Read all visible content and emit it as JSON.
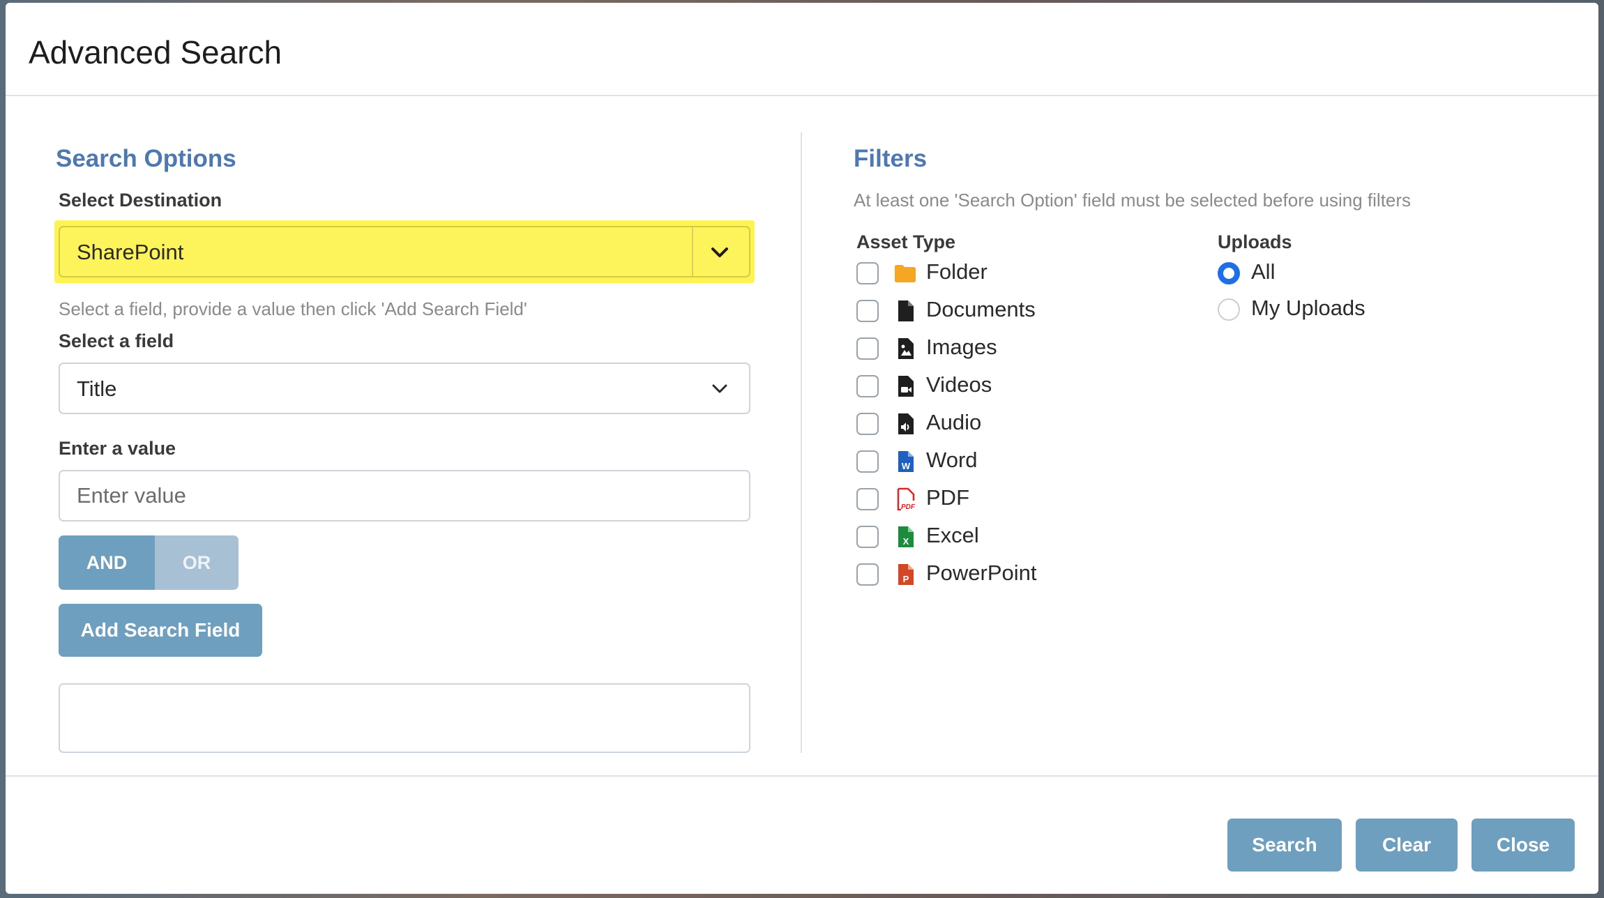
{
  "dialog": {
    "title": "Advanced Search"
  },
  "search_options": {
    "heading": "Search Options",
    "destination_label": "Select Destination",
    "destination_value": "SharePoint",
    "hint": "Select a field, provide a value then click 'Add Search Field'",
    "field_label": "Select a field",
    "field_value": "Title",
    "value_label": "Enter a value",
    "value_placeholder": "Enter value",
    "value_current": "",
    "operator_and": "AND",
    "operator_or": "OR",
    "operator_selected": "AND",
    "add_button": "Add Search Field",
    "search_fields_box": ""
  },
  "filters": {
    "heading": "Filters",
    "hint": "At least one 'Search Option' field must be selected before using filters",
    "asset_type_label": "Asset Type",
    "asset_types": [
      {
        "label": "Folder",
        "icon": "folder-icon",
        "checked": false
      },
      {
        "label": "Documents",
        "icon": "document-icon",
        "checked": false
      },
      {
        "label": "Images",
        "icon": "image-file-icon",
        "checked": false
      },
      {
        "label": "Videos",
        "icon": "video-file-icon",
        "checked": false
      },
      {
        "label": "Audio",
        "icon": "audio-file-icon",
        "checked": false
      },
      {
        "label": "Word",
        "icon": "word-file-icon",
        "checked": false
      },
      {
        "label": "PDF",
        "icon": "pdf-file-icon",
        "checked": false
      },
      {
        "label": "Excel",
        "icon": "excel-file-icon",
        "checked": false
      },
      {
        "label": "PowerPoint",
        "icon": "powerpoint-file-icon",
        "checked": false
      }
    ],
    "uploads_label": "Uploads",
    "uploads": [
      {
        "label": "All",
        "checked": true
      },
      {
        "label": "My Uploads",
        "checked": false
      }
    ]
  },
  "footer": {
    "search": "Search",
    "clear": "Clear",
    "close": "Close"
  },
  "colors": {
    "accent": "#6f9fbe",
    "heading": "#4e78b0",
    "highlight": "#fdf452",
    "radio_checked": "#1f6fe8"
  }
}
